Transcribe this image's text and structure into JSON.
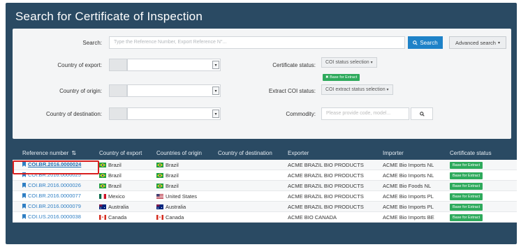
{
  "page": {
    "title": "Search for Certificate of Inspection"
  },
  "search": {
    "label": "Search:",
    "placeholder": "Type the Reference Number, Export Reference N°...",
    "button_label": "Search",
    "advanced_label": "Advanced search"
  },
  "filters": {
    "country_of_export_label": "Country of export:",
    "country_of_origin_label": "Country of origin:",
    "country_of_destination_label": "Country of destination:",
    "certificate_status_label": "Certificate status:",
    "certificate_status_value": "COI status selection",
    "certificate_status_badge": "Base for Extract",
    "extract_status_label": "Extract COI status:",
    "extract_status_value": "COI extract status selection",
    "commodity_label": "Commodity:",
    "commodity_placeholder": "Please provide code, model..."
  },
  "table": {
    "columns": [
      "Reference number",
      "Country of export",
      "Countries of origin",
      "Country of destination",
      "Exporter",
      "Importer",
      "Certificate status"
    ],
    "rows": [
      {
        "ref": "COI.BR.2016.0000024",
        "export": "Brazil",
        "export_flag": "brazil-flag-icon",
        "origin": "Brazil",
        "origin_flag": "brazil-flag-icon",
        "destination": "",
        "exporter": "ACME BRAZIL BIO PRODUCTS",
        "importer": "ACME Bio Imports NL",
        "status": "Base for Extract"
      },
      {
        "ref": "COI.BR.2016.0000025",
        "export": "Brazil",
        "export_flag": "brazil-flag-icon",
        "origin": "Brazil",
        "origin_flag": "brazil-flag-icon",
        "destination": "",
        "exporter": "ACME BRAZIL BIO PRODUCTS",
        "importer": "ACME Bio Imports NL",
        "status": "Base for Extract"
      },
      {
        "ref": "COI.BR.2016.0000026",
        "export": "Brazil",
        "export_flag": "brazil-flag-icon",
        "origin": "Brazil",
        "origin_flag": "brazil-flag-icon",
        "destination": "",
        "exporter": "ACME BRAZIL BIO PRODUCTS",
        "importer": "ACME Bio Foods NL",
        "status": "Base for Extract"
      },
      {
        "ref": "COI.BR.2016.0000077",
        "export": "Mexico",
        "export_flag": "mexico-flag-icon",
        "origin": "United States",
        "origin_flag": "usa-flag-icon",
        "destination": "",
        "exporter": "ACME BRAZIL BIO PRODUCTS",
        "importer": "ACME Bio Imports PL",
        "status": "Base for Extract"
      },
      {
        "ref": "COI.BR.2016.0000079",
        "export": "Australia",
        "export_flag": "australia-flag-icon",
        "origin": "Australia",
        "origin_flag": "australia-flag-icon",
        "destination": "",
        "exporter": "ACME BRAZIL BIO PRODUCTS",
        "importer": "ACME Bio Imports PL",
        "status": "Base for Extract"
      },
      {
        "ref": "COI.US.2016.0000038",
        "export": "Canada",
        "export_flag": "canada-flag-icon",
        "origin": "Canada",
        "origin_flag": "canada-flag-icon",
        "destination": "",
        "exporter": "ACME BIO CANADA",
        "importer": "ACME Bio Imports BE",
        "status": "Base for Extract"
      }
    ]
  },
  "colors": {
    "panel": "#2a4a63",
    "primary_button": "#1e82c8",
    "status_badge": "#2eaa5c",
    "link": "#2f7fc4",
    "highlight": "#d81e1e"
  }
}
